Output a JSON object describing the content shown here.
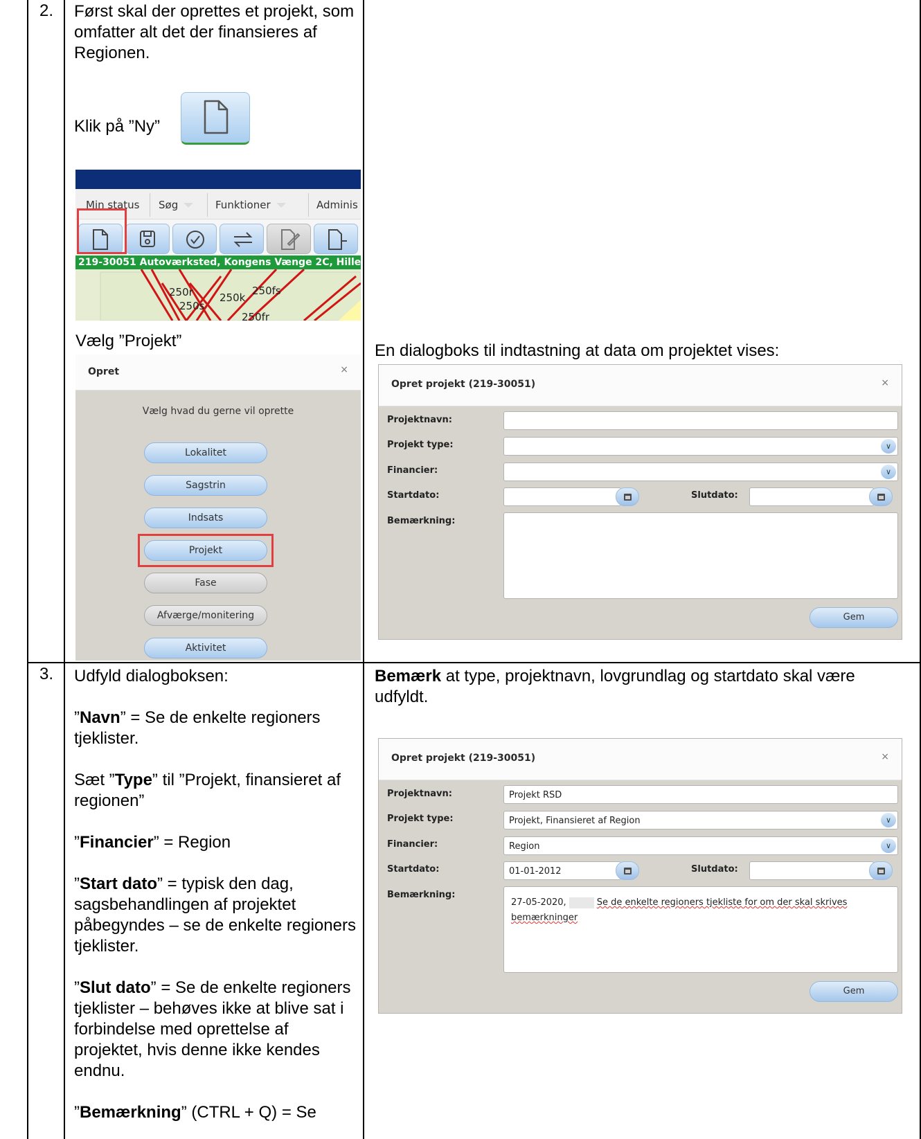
{
  "rows": [
    {
      "number": "2."
    },
    {
      "number": "3."
    }
  ],
  "step2": {
    "intro": "Først skal der oprettes et projekt, som omfatter alt det der finansieres af Regionen.",
    "click_new": "Klik på ”Ny”",
    "choose_project": "Vælg ”Projekt”",
    "dialog_caption": "En dialogboks til indtastning at data om projektet vises:"
  },
  "app_screenshot": {
    "menu": [
      "Min status",
      "Søg",
      "Funktioner",
      "Adminis"
    ],
    "address_bar": "219-30051 Autoværksted, Kongens Vænge 2C, Hille",
    "map_labels": [
      "250r",
      "250s",
      "250k",
      "250fs",
      "250fr"
    ]
  },
  "opret_dialog": {
    "title": "Opret",
    "close": "×",
    "prompt": "Vælg hvad du gerne vil oprette",
    "buttons": [
      "Lokalitet",
      "Sagstrin",
      "Indsats",
      "Projekt",
      "Fase",
      "Afværge/monitering",
      "Aktivitet"
    ]
  },
  "project_dialog_empty": {
    "title": "Opret projekt (219-30051)",
    "close": "×",
    "labels": {
      "name": "Projektnavn:",
      "type": "Projekt type:",
      "financier": "Financier:",
      "start": "Startdato:",
      "end": "Slutdato:",
      "remark": "Bemærkning:"
    },
    "values": {
      "name": "",
      "type": "",
      "financier": "",
      "start": "",
      "end": "",
      "remark": ""
    },
    "save": "Gem"
  },
  "step3": {
    "fill_in": "Udfyld dialogboksen:",
    "name_line": {
      "pre": "”",
      "key": "Navn",
      "post": "” = Se de enkelte regioners tjeklister."
    },
    "type_line": {
      "pre": "Sæt ”",
      "key": "Type",
      "post": "” til ”Projekt, finansieret af regionen”"
    },
    "financier_line": {
      "pre": "”",
      "key": "Financier",
      "post": "” = Region"
    },
    "start_line": {
      "pre": "”",
      "key": "Start dato",
      "post": "” = typisk den dag, sagsbehandlingen af projektet påbegyndes – se de enkelte regioners tjeklister."
    },
    "end_line": {
      "pre": "”",
      "key": "Slut dato",
      "post": "” = Se de enkelte regioners tjeklister – behøves ikke at blive sat i forbindelse med oprettelse af projektet, hvis denne ikke kendes endnu."
    },
    "remark_line": {
      "pre": "”",
      "key": "Bemærkning",
      "post": "” (CTRL + Q) = Se"
    },
    "note": {
      "key": "Bemærk",
      "post": " at type, projektnavn, lovgrundlag og startdato skal være udfyldt."
    }
  },
  "project_dialog_filled": {
    "title": "Opret projekt (219-30051)",
    "close": "×",
    "labels": {
      "name": "Projektnavn:",
      "type": "Projekt type:",
      "financier": "Financier:",
      "start": "Startdato:",
      "end": "Slutdato:",
      "remark": "Bemærkning:"
    },
    "values": {
      "name": "Projekt RSD",
      "type": "Projekt, Finansieret af Region",
      "financier": "Region",
      "start": "01-01-2012",
      "end": "",
      "remark_date": "27-05-2020,",
      "remark_text": "Se de enkelte regioners tjekliste for om der skal skrives bemærkninger"
    },
    "save": "Gem"
  }
}
